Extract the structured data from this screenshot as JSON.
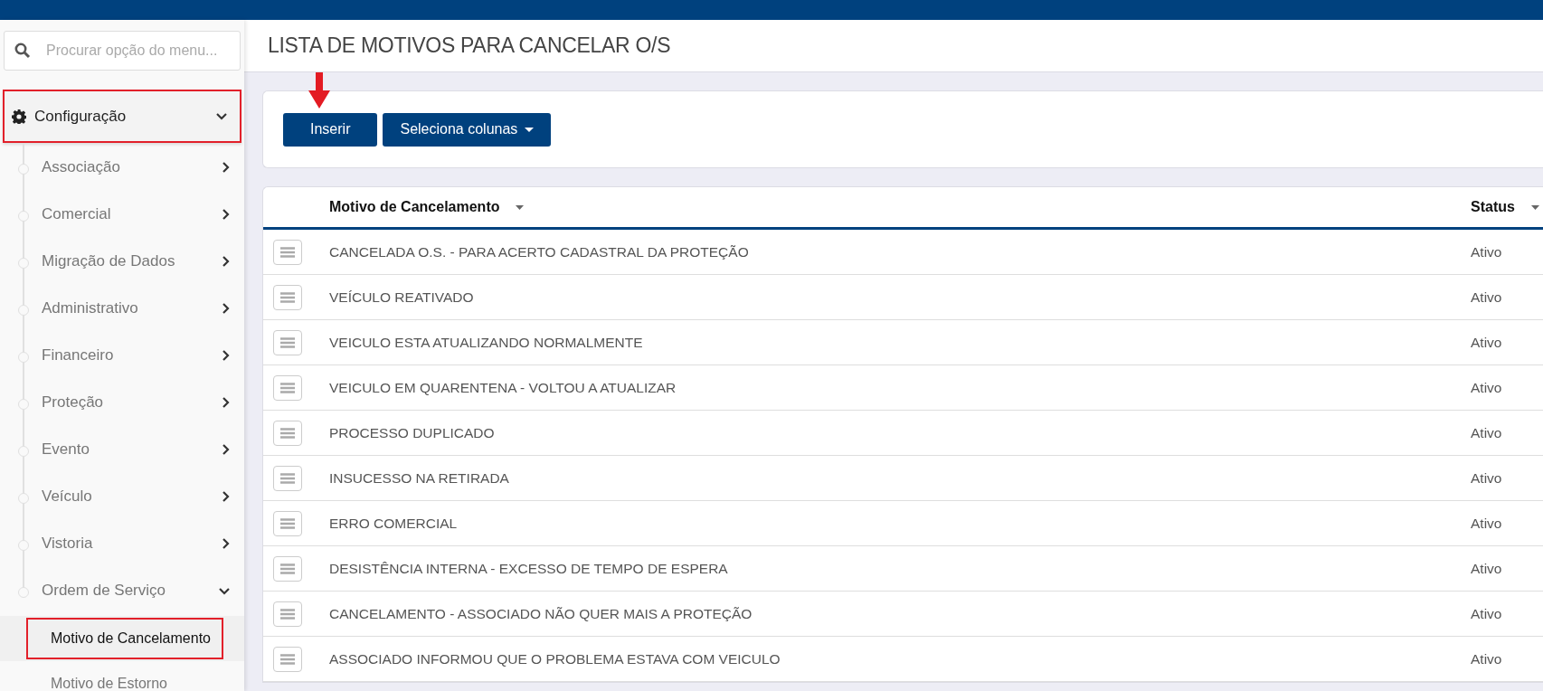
{
  "sidebar": {
    "search": {
      "placeholder": "Procurar opção do menu..."
    },
    "section": {
      "label": "Configuração",
      "expanded": true,
      "highlighted": true
    },
    "items": [
      {
        "label": "Associação",
        "expanded": false
      },
      {
        "label": "Comercial",
        "expanded": false
      },
      {
        "label": "Migração de Dados",
        "expanded": false
      },
      {
        "label": "Administrativo",
        "expanded": false
      },
      {
        "label": "Financeiro",
        "expanded": false
      },
      {
        "label": "Proteção",
        "expanded": false
      },
      {
        "label": "Evento",
        "expanded": false
      },
      {
        "label": "Veículo",
        "expanded": false
      },
      {
        "label": "Vistoria",
        "expanded": false
      },
      {
        "label": "Ordem de Serviço",
        "expanded": true,
        "children": [
          {
            "label": "Motivo de Cancelamento",
            "selected": true,
            "highlighted": true
          },
          {
            "label": "Motivo de Estorno",
            "selected": false,
            "highlighted": false
          }
        ]
      }
    ]
  },
  "page_title": "LISTA DE MOTIVOS PARA CANCELAR O/S",
  "toolbar": {
    "buttons": [
      {
        "label": "Inserir",
        "kind": "plain",
        "marked": true
      },
      {
        "label": "Seleciona colunas",
        "kind": "dropdown",
        "marked": false
      }
    ]
  },
  "table": {
    "columns": [
      "Motivo de Cancelamento",
      "Status"
    ],
    "rows": [
      [
        "CANCELADA O.S. - PARA ACERTO CADASTRAL DA PROTEÇÃO",
        "Ativo"
      ],
      [
        "VEÍCULO REATIVADO",
        "Ativo"
      ],
      [
        "VEICULO ESTA ATUALIZANDO NORMALMENTE",
        "Ativo"
      ],
      [
        "VEICULO EM QUARENTENA - VOLTOU A ATUALIZAR",
        "Ativo"
      ],
      [
        "PROCESSO DUPLICADO",
        "Ativo"
      ],
      [
        "INSUCESSO NA RETIRADA",
        "Ativo"
      ],
      [
        "ERRO COMERCIAL",
        "Ativo"
      ],
      [
        "DESISTÊNCIA INTERNA - EXCESSO DE TEMPO DE ESPERA",
        "Ativo"
      ],
      [
        "CANCELAMENTO - ASSOCIADO NÃO QUER MAIS A PROTEÇÃO",
        "Ativo"
      ],
      [
        "ASSOCIADO INFORMOU QUE O PROBLEMA ESTAVA COM VEICULO",
        "Ativo"
      ]
    ]
  }
}
